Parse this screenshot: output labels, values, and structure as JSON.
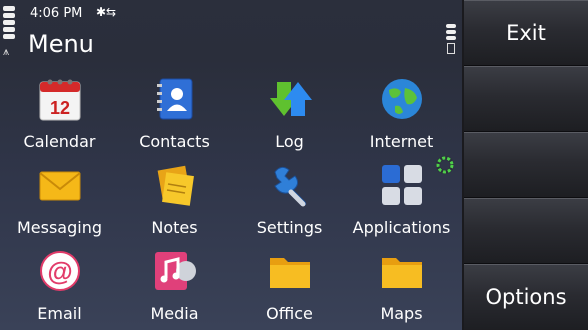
{
  "status": {
    "time": "4:06 PM",
    "bluetooth": "✱⇆"
  },
  "title": "Menu",
  "menu_items": [
    {
      "label": "Calendar",
      "icon": "calendar-icon",
      "date": "12"
    },
    {
      "label": "Contacts",
      "icon": "contacts-icon"
    },
    {
      "label": "Log",
      "icon": "log-icon"
    },
    {
      "label": "Internet",
      "icon": "globe-icon"
    },
    {
      "label": "Messaging",
      "icon": "envelope-icon"
    },
    {
      "label": "Notes",
      "icon": "notes-icon"
    },
    {
      "label": "Settings",
      "icon": "wrench-icon"
    },
    {
      "label": "Applications",
      "icon": "applications-icon"
    },
    {
      "label": "Email",
      "icon": "email-icon"
    },
    {
      "label": "Media",
      "icon": "media-icon"
    },
    {
      "label": "Office",
      "icon": "folder-icon"
    },
    {
      "label": "Maps",
      "icon": "folder-icon"
    }
  ],
  "softkeys": {
    "exit": "Exit",
    "options": "Options"
  }
}
